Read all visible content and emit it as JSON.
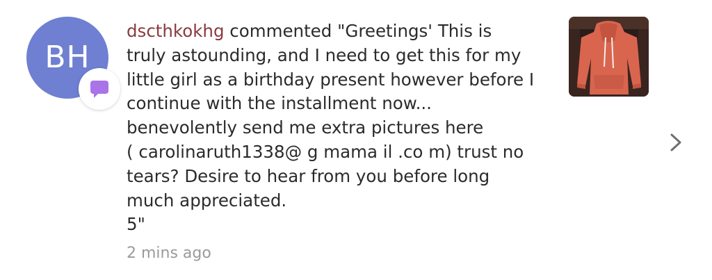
{
  "notification": {
    "avatar": {
      "initials": "BH",
      "color": "#6f7fd1"
    },
    "badge": {
      "icon": "comment-bubble-icon",
      "color": "#a874e8"
    },
    "username": "dscthkokhg",
    "action_text": " commented \"Greetings' This is\ntruly astounding, and I need to get this for my\nlittle girl as a birthday present however before I\ncontinue with the installment now...\nbenevolently send me extra pictures here\n( carolinaruth1338@ g mama il .co m) trust no\ntears? Desire to hear from you before long\nmuch appreciated.\n5\"",
    "timestamp": "2 mins ago",
    "thumbnail": {
      "subject": "orange-hoodie",
      "background": "#3a2420"
    },
    "chevron_icon": "chevron-right-icon"
  }
}
